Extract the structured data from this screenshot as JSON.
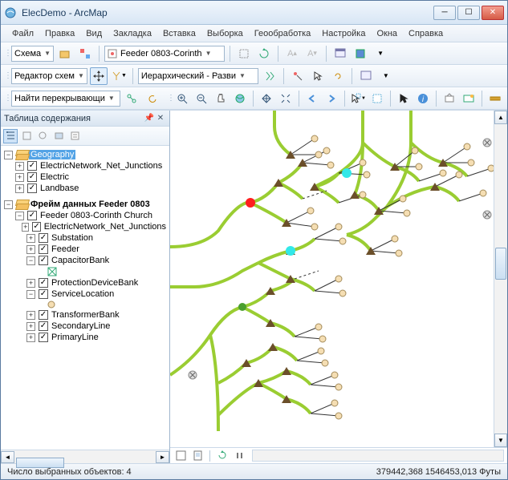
{
  "title": "ElecDemo - ArcMap",
  "menu": [
    "Файл",
    "Правка",
    "Вид",
    "Закладка",
    "Вставка",
    "Выборка",
    "Геообработка",
    "Настройка",
    "Окна",
    "Справка"
  ],
  "row1": {
    "scheme_label": "Схема",
    "feeder_label": "Feeder 0803-Corinth"
  },
  "row2": {
    "editor_label": "Редактор схем",
    "layout_label": "Иерархический - Разви"
  },
  "row3": {
    "find_label": "Найти перекрывающи"
  },
  "toc": {
    "title": "Таблица содержания",
    "group1": "Geography",
    "g1a": "ElectricNetwork_Net_Junctions",
    "g1b": "Electric",
    "g1c": "Landbase",
    "group2": "Фрейм данных Feeder 0803",
    "g2a": "Feeder 0803-Corinth Church",
    "g2a1": "ElectricNetwork_Net_Junctions",
    "g2a2": "Substation",
    "g2a3": "Feeder",
    "g2a4": "CapacitorBank",
    "g2a5": "ProtectionDeviceBank",
    "g2a6": "ServiceLocation",
    "g2a7": "TransformerBank",
    "g2a8": "SecondaryLine",
    "g2a9": "PrimaryLine"
  },
  "status": {
    "selected": "Число выбранных объектов: 4",
    "coords": "379442,368 1546453,013 Футы"
  }
}
